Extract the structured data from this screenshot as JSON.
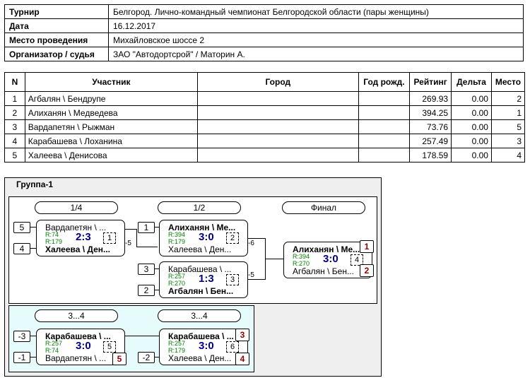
{
  "info": {
    "tournament_label": "Турнир",
    "tournament": "Белгород. Лично-командный чемпионат Белгородской области (пары женщины)",
    "date_label": "Дата",
    "date": "16.12.2017",
    "venue_label": "Место проведения",
    "venue": "Михайловское шоссе 2",
    "organizer_label": "Организатор / судья",
    "organizer": "ЗАО \"Автодортсрой\" / Маторин А."
  },
  "players": {
    "headers": [
      "N",
      "Участник",
      "Город",
      "Год рожд.",
      "Рейтинг",
      "Дельта",
      "Место"
    ],
    "rows": [
      {
        "n": "1",
        "name": "Агбалян \\ Бендрупе",
        "city": "",
        "year": "",
        "rating": "269.93",
        "delta": "0.00",
        "place": "2"
      },
      {
        "n": "2",
        "name": "Алиханян \\ Медведева",
        "city": "",
        "year": "",
        "rating": "394.25",
        "delta": "0.00",
        "place": "1"
      },
      {
        "n": "3",
        "name": "Вардапетян \\ Рыжман",
        "city": "",
        "year": "",
        "rating": "73.76",
        "delta": "0.00",
        "place": "5"
      },
      {
        "n": "4",
        "name": "Карабашева \\ Лоханина",
        "city": "",
        "year": "",
        "rating": "257.49",
        "delta": "0.00",
        "place": "3"
      },
      {
        "n": "5",
        "name": "Халеева \\ Денисова",
        "city": "",
        "year": "",
        "rating": "178.59",
        "delta": "0.00",
        "place": "4"
      }
    ]
  },
  "group": {
    "title": "Группа-1",
    "rounds": {
      "quarter": "1/4",
      "semi": "1/2",
      "final": "Финал",
      "cons1": "3...4",
      "cons2": "3...4"
    },
    "m_qf": {
      "p1": "Вардапетян \\ ...",
      "p2": "Халеева \\ Ден...",
      "r1": "R:74",
      "r2": "R:179",
      "score": "2:3",
      "num": "1",
      "seed1": "5",
      "seed2": "4",
      "delta": "-5"
    },
    "m_sf1": {
      "p1": "Алиханян \\ Ме...",
      "p2": "Халеева \\ Ден...",
      "r1": "R:394",
      "r2": "R:179",
      "score": "3:0",
      "num": "2",
      "seed1": "1",
      "delta": "-6"
    },
    "m_sf2": {
      "p1": "Карабашева \\ ...",
      "p2": "Агбалян \\ Бен...",
      "r1": "R:257",
      "r2": "R:270",
      "score": "1:3",
      "num": "3",
      "seed1": "3",
      "seed2": "2",
      "delta": "-5"
    },
    "m_final": {
      "p1": "Алиханян \\ Ме...",
      "p2": "Агбалян \\ Бен...",
      "r1": "R:394",
      "r2": "R:270",
      "score": "3:0",
      "num": "4",
      "place1": "1",
      "place2": "2"
    },
    "m_c1": {
      "p1": "Карабашева \\ ...",
      "p2": "Вардапетян \\ ...",
      "r1": "R:257",
      "r2": "R:74",
      "score": "3:0",
      "num": "5",
      "seed1": "-3",
      "seed2": "-1",
      "place2": "5"
    },
    "m_c2": {
      "p1": "Карабашева \\ ...",
      "p2": "Халеева \\ Ден...",
      "r1": "R:257",
      "r2": "R:179",
      "score": "3:0",
      "num": "6",
      "seed2": "-2",
      "place1": "3",
      "place2": "4"
    }
  }
}
